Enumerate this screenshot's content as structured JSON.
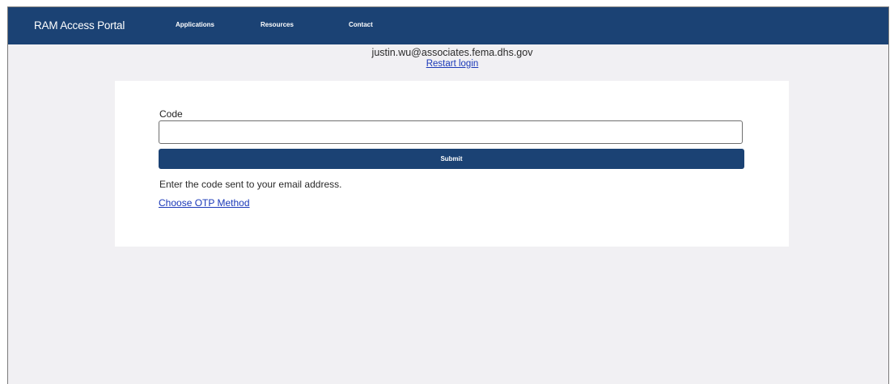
{
  "navbar": {
    "brand": "RAM Access Portal",
    "links": [
      {
        "label": "Applications"
      },
      {
        "label": "Resources"
      },
      {
        "label": "Contact"
      }
    ]
  },
  "session": {
    "email": "justin.wu@associates.fema.dhs.gov",
    "restart_label": "Restart login"
  },
  "form": {
    "code_label": "Code",
    "code_value": "",
    "submit_label": "Submit",
    "hint": "Enter the code sent to your email address.",
    "otp_method_label": "Choose OTP Method"
  },
  "colors": {
    "navbar_bg": "#1b4274",
    "page_bg": "#f1f0f3",
    "link": "#1a38b8"
  }
}
